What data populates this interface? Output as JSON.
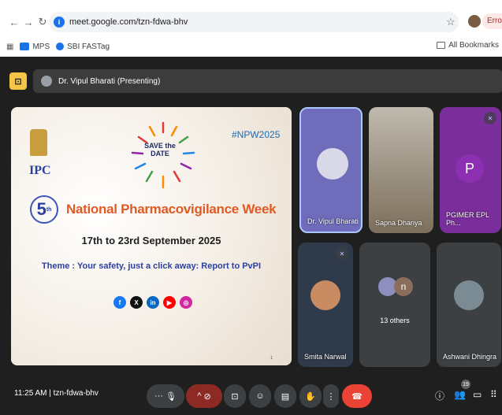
{
  "browser": {
    "url": "meet.google.com/tzn-fdwa-bhv",
    "error_label": "Error",
    "bookmarks": [
      {
        "label": "MPS",
        "color": "#1a73e8"
      },
      {
        "label": "SBI FASTag",
        "color": "#1a73e8"
      }
    ],
    "all_bookmarks_label": "All Bookmarks"
  },
  "meet": {
    "presenter_bar": "Dr. Vipul Bharati (Presenting)",
    "slide": {
      "hashtag": "#NPW2025",
      "save_the_date": "SAVE the DATE",
      "number": "5",
      "number_suffix": "th",
      "title": "National Pharmacovigilance Week",
      "dates": "17th to 23rd September 2025",
      "theme": "Theme : Your safety, just a click away: Report to PvPI",
      "emblem_org": "IPC",
      "page_number": "1",
      "social_icons": [
        "facebook-icon",
        "x-icon",
        "linkedin-icon",
        "youtube-icon",
        "instagram-icon"
      ]
    },
    "tiles": [
      {
        "name": "Dr. Vipul Bharati"
      },
      {
        "name": "Sapna Dhariya"
      },
      {
        "name": "PGIMER EPL Ph...",
        "initial": "P"
      },
      {
        "name": "Smita Narwal"
      },
      {
        "name": "13 others",
        "initial": "n"
      },
      {
        "name": "Ashwani Dhingra"
      }
    ],
    "bottom": {
      "time_code": "11:25 AM | tzn-fdwa-bhv",
      "people_count": "19"
    },
    "colors": {
      "accent": "#a8c7fa",
      "end_call": "#ea4335",
      "slide_title": "#e05a24"
    }
  }
}
